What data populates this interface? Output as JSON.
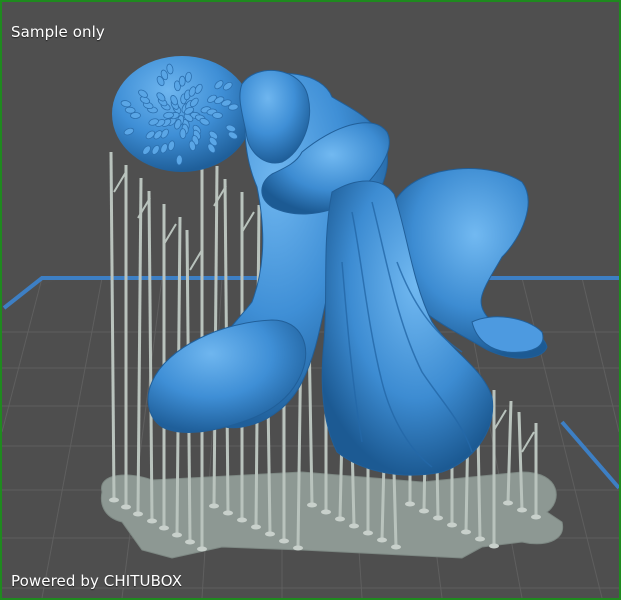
{
  "viewport": {
    "overlay_top_left": "Sample only",
    "overlay_bottom_left": "Powered by CHITUBOX"
  },
  "scene": {
    "model_color": "#3f8fd6",
    "model_highlight": "#6fb6ef",
    "model_shadow": "#1f5f9a",
    "support_color": "#b9c3bd",
    "raft_color": "#8f9a95",
    "plate_grid_color": "#5e5e5e",
    "plate_border_color": "#3d7fc4",
    "frame_color": "#1f8a1f"
  }
}
